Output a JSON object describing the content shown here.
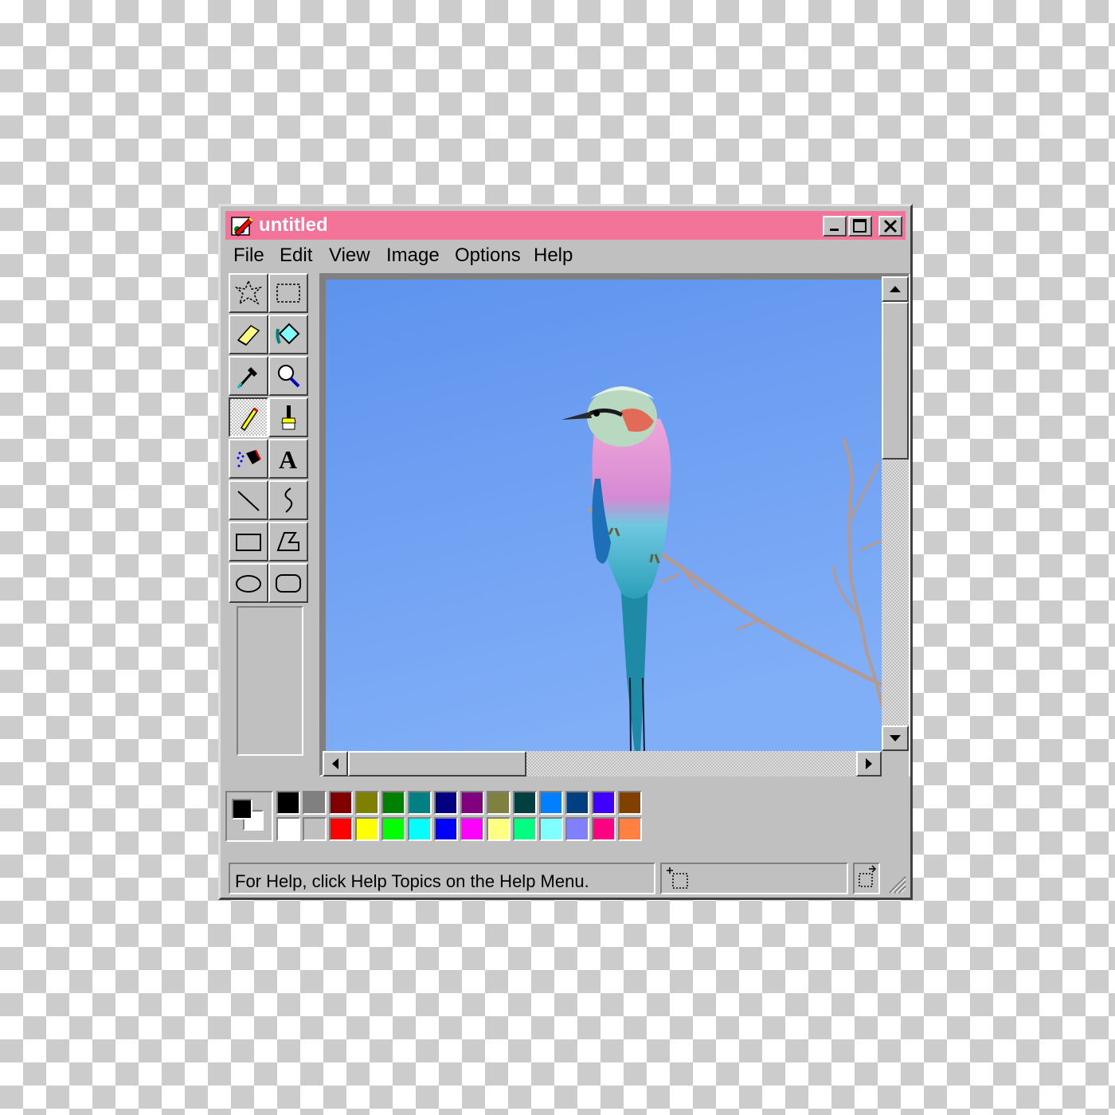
{
  "window": {
    "title": "untitled",
    "controls": {
      "minimize": "minimize-icon",
      "maximize": "maximize-icon",
      "close": "close-icon"
    },
    "accent_color": "#f47399"
  },
  "menu": {
    "items": [
      {
        "label": "File"
      },
      {
        "label": "Edit"
      },
      {
        "label": "View"
      },
      {
        "label": "Image"
      },
      {
        "label": "Options"
      },
      {
        "label": "Help"
      }
    ]
  },
  "tools": [
    {
      "icon": "free-form-select-icon"
    },
    {
      "icon": "rect-select-icon"
    },
    {
      "icon": "eraser-icon"
    },
    {
      "icon": "fill-bucket-icon"
    },
    {
      "icon": "color-picker-icon"
    },
    {
      "icon": "magnifier-icon"
    },
    {
      "icon": "pencil-icon",
      "active": true
    },
    {
      "icon": "brush-icon"
    },
    {
      "icon": "airbrush-icon"
    },
    {
      "icon": "text-icon",
      "glyph": "A"
    },
    {
      "icon": "line-icon"
    },
    {
      "icon": "curve-icon"
    },
    {
      "icon": "rectangle-icon"
    },
    {
      "icon": "polygon-icon"
    },
    {
      "icon": "ellipse-icon"
    },
    {
      "icon": "rounded-rectangle-icon"
    }
  ],
  "canvas": {
    "image": "bird-on-branch-photo",
    "sky_color": "#6f9ff0"
  },
  "colors": {
    "foreground": "#000000",
    "background": "#ffffff",
    "palette_top": [
      "#000000",
      "#808080",
      "#800000",
      "#808000",
      "#008000",
      "#008080",
      "#000080",
      "#800080",
      "#808040",
      "#004040",
      "#0080ff",
      "#004080",
      "#4000ff",
      "#804000"
    ],
    "palette_bottom": [
      "#ffffff",
      "#c0c0c0",
      "#ff0000",
      "#ffff00",
      "#00ff00",
      "#00ffff",
      "#0000ff",
      "#ff00ff",
      "#ffff80",
      "#00ff80",
      "#80ffff",
      "#8080ff",
      "#ff0080",
      "#ff8040"
    ]
  },
  "status": {
    "help_text": "For Help, click Help Topics on the Help Menu."
  }
}
